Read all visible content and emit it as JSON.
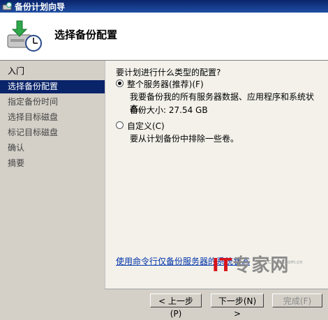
{
  "window": {
    "title": "备份计划向导"
  },
  "header": {
    "page_title": "选择备份配置"
  },
  "sidebar": {
    "items": [
      {
        "label": "入门"
      },
      {
        "label": "选择备份配置"
      },
      {
        "label": "指定备份时间"
      },
      {
        "label": "选择目标磁盘"
      },
      {
        "label": "标记目标磁盘"
      },
      {
        "label": "确认"
      },
      {
        "label": "摘要"
      }
    ]
  },
  "main": {
    "question": "要计划进行什么类型的配置?",
    "option_full": {
      "label": "整个服务器(推荐)(F)",
      "description": "我要备份我的所有服务器数据、应用程序和系统状态。",
      "size_text": "备份大小: 27.54 GB",
      "selected": true
    },
    "option_custom": {
      "label": "自定义(C)",
      "description": "要从计划备份中排除一些卷。",
      "selected": false
    },
    "link": "使用命令行仅备份服务器的系统状态"
  },
  "buttons": {
    "back": "< 上一步(P)",
    "next": "下一步(N) >",
    "finish": "完成(F)"
  },
  "watermark": {
    "text_it": "IT",
    "text_rest": "专家网",
    "sub": "Ctocio.com.cn"
  }
}
